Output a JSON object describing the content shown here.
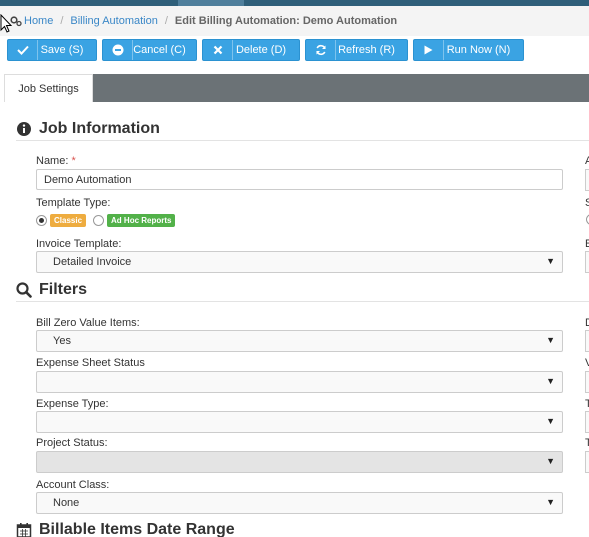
{
  "breadcrumb": {
    "home": "Home",
    "parent": "Billing Automation",
    "current": "Edit Billing Automation: Demo Automation",
    "separator": "/"
  },
  "toolbar": {
    "save_label": "Save (S)",
    "cancel_label": "Cancel (C)",
    "delete_label": "Delete (D)",
    "refresh_label": "Refresh (R)",
    "run_label": "Run Now (N)"
  },
  "tabs": [
    {
      "label": "Job Settings",
      "active": true
    }
  ],
  "job_information": {
    "title": "Job Information",
    "name_label": "Name:",
    "required_mark": "*",
    "name_value": "Demo Automation",
    "template_type_label": "Template Type:",
    "template_options": [
      {
        "label": "Classic",
        "selected": true,
        "color": "#eeac3f"
      },
      {
        "label": "Ad Hoc Reports",
        "selected": false,
        "color": "#52b149"
      }
    ],
    "invoice_template_label": "Invoice Template:",
    "invoice_template_value": "Detailed Invoice"
  },
  "filters": {
    "title": "Filters",
    "bill_zero_label": "Bill Zero Value Items:",
    "bill_zero_value": "Yes",
    "expense_sheet_status_label": "Expense Sheet Status",
    "expense_sheet_status_value": "",
    "expense_type_label": "Expense Type:",
    "expense_type_value": "",
    "project_status_label": "Project Status:",
    "project_status_value": "",
    "account_class_label": "Account Class:",
    "account_class_value": "None"
  },
  "date_range": {
    "title": "Billable Items Date Range"
  },
  "right_column_labels": [
    "A",
    "S",
    "E",
    "D",
    "V",
    "T",
    "T"
  ],
  "icons": {
    "cog": "cog-icon",
    "info": "info-circle-icon",
    "search": "search-icon",
    "calendar": "calendar-icon",
    "check": "check-icon",
    "minus": "minus-circle-icon",
    "close": "close-icon",
    "refresh": "refresh-icon",
    "play": "play-icon"
  },
  "colors": {
    "button_blue": "#3aa3e3",
    "link_blue": "#3a87c7",
    "tab_strip": "#6b7276",
    "required": "#d9534f"
  }
}
